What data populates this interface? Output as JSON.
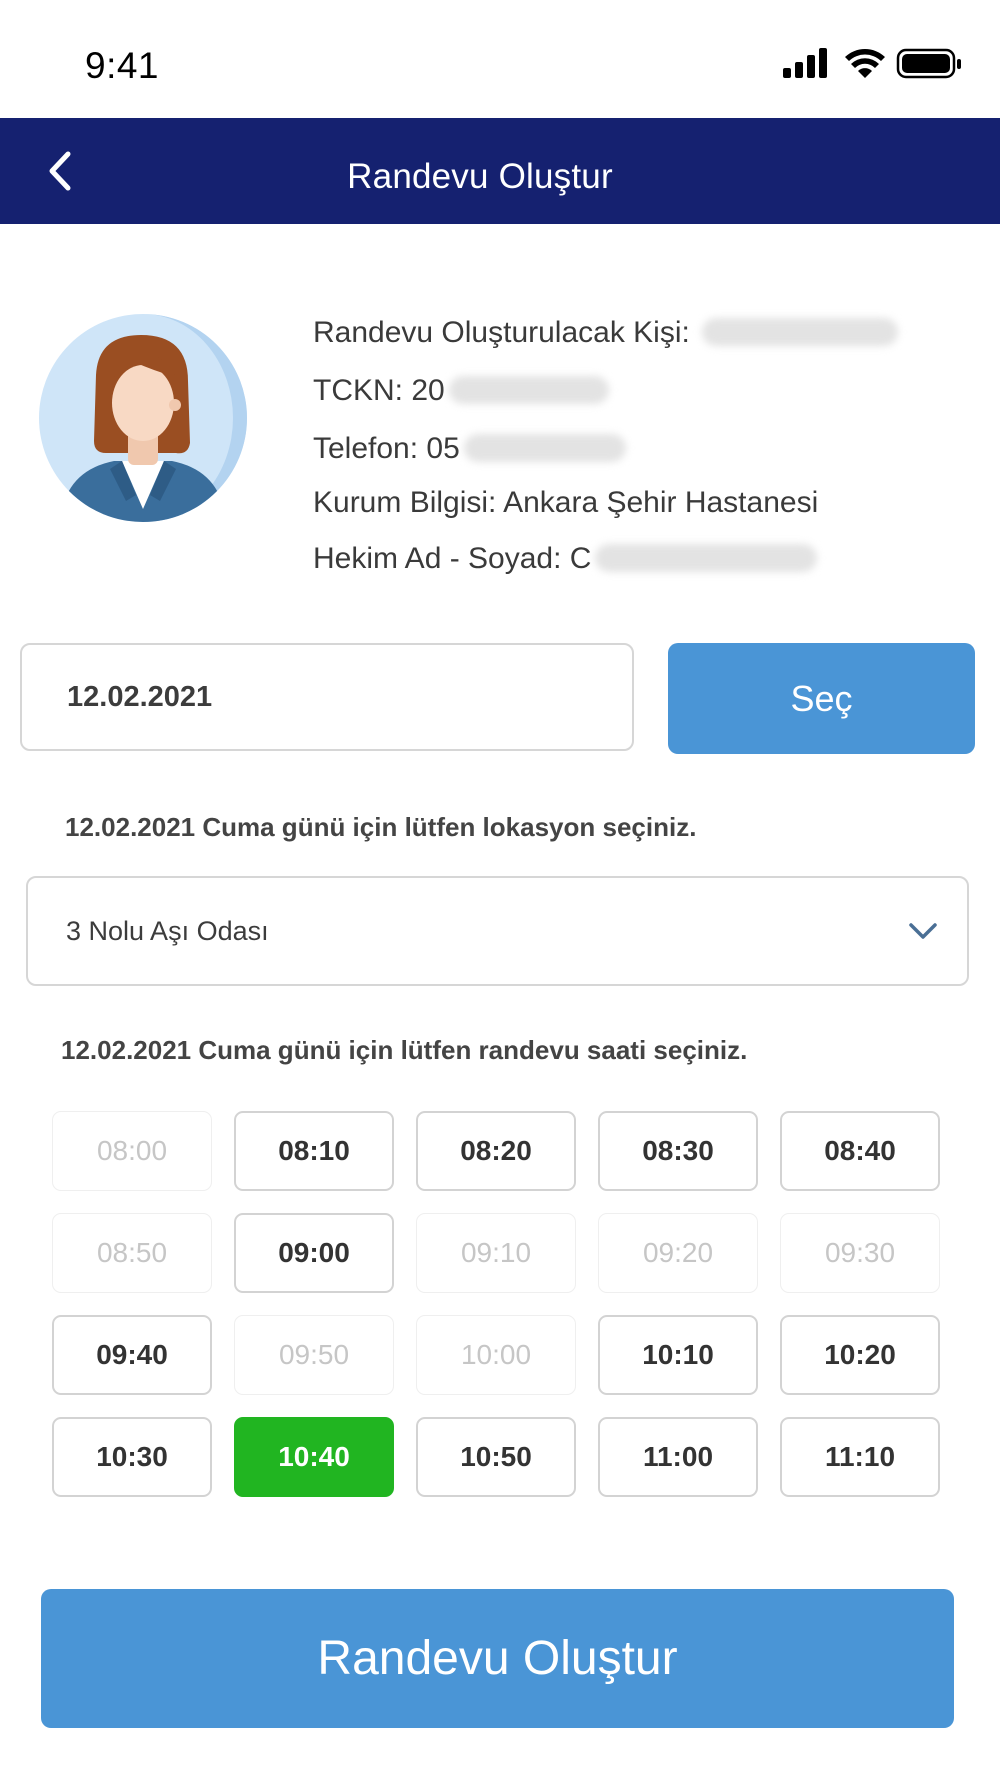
{
  "status_bar": {
    "time": "9:41"
  },
  "header": {
    "title": "Randevu Oluştur"
  },
  "person": {
    "rows": [
      {
        "label": "Randevu Oluşturulacak Kişi: ",
        "value": "",
        "redacted": true
      },
      {
        "label": "TCKN: ",
        "value": "20",
        "redacted": true
      },
      {
        "label": "Telefon: ",
        "value": "05",
        "redacted": true
      },
      {
        "label": "Kurum Bilgisi: ",
        "value": "Ankara Şehir Hastanesi",
        "redacted": false
      },
      {
        "label": "Hekim Ad - Soyad: ",
        "value": "C",
        "redacted": true
      }
    ]
  },
  "date_picker": {
    "value": "12.02.2021",
    "button_label": "Seç"
  },
  "location": {
    "prompt": "12.02.2021 Cuma günü için lütfen lokasyon seçiniz.",
    "selected": "3 Nolu Aşı Odası"
  },
  "time_slots": {
    "prompt": "12.02.2021 Cuma günü için lütfen randevu saati seçiniz.",
    "slots": [
      {
        "time": "08:00",
        "state": "disabled"
      },
      {
        "time": "08:10",
        "state": "available"
      },
      {
        "time": "08:20",
        "state": "available"
      },
      {
        "time": "08:30",
        "state": "available"
      },
      {
        "time": "08:40",
        "state": "available"
      },
      {
        "time": "08:50",
        "state": "disabled"
      },
      {
        "time": "09:00",
        "state": "available"
      },
      {
        "time": "09:10",
        "state": "disabled"
      },
      {
        "time": "09:20",
        "state": "disabled"
      },
      {
        "time": "09:30",
        "state": "disabled"
      },
      {
        "time": "09:40",
        "state": "available"
      },
      {
        "time": "09:50",
        "state": "disabled"
      },
      {
        "time": "10:00",
        "state": "disabled"
      },
      {
        "time": "10:10",
        "state": "available"
      },
      {
        "time": "10:20",
        "state": "available"
      },
      {
        "time": "10:30",
        "state": "available"
      },
      {
        "time": "10:40",
        "state": "selected"
      },
      {
        "time": "10:50",
        "state": "available"
      },
      {
        "time": "11:00",
        "state": "available"
      },
      {
        "time": "11:10",
        "state": "available"
      }
    ]
  },
  "actions": {
    "create_label": "Randevu Oluştur"
  },
  "colors": {
    "header_bg": "#152170",
    "primary_button": "#4a95d6",
    "selected_slot": "#21b521",
    "disabled_text": "#c6c6c6"
  },
  "icons": {
    "back": "chevron-left-icon",
    "dropdown": "chevron-down-icon",
    "avatar": "female-user-avatar-icon",
    "signal": "cellular-signal-icon",
    "wifi": "wifi-icon",
    "battery": "battery-icon"
  }
}
